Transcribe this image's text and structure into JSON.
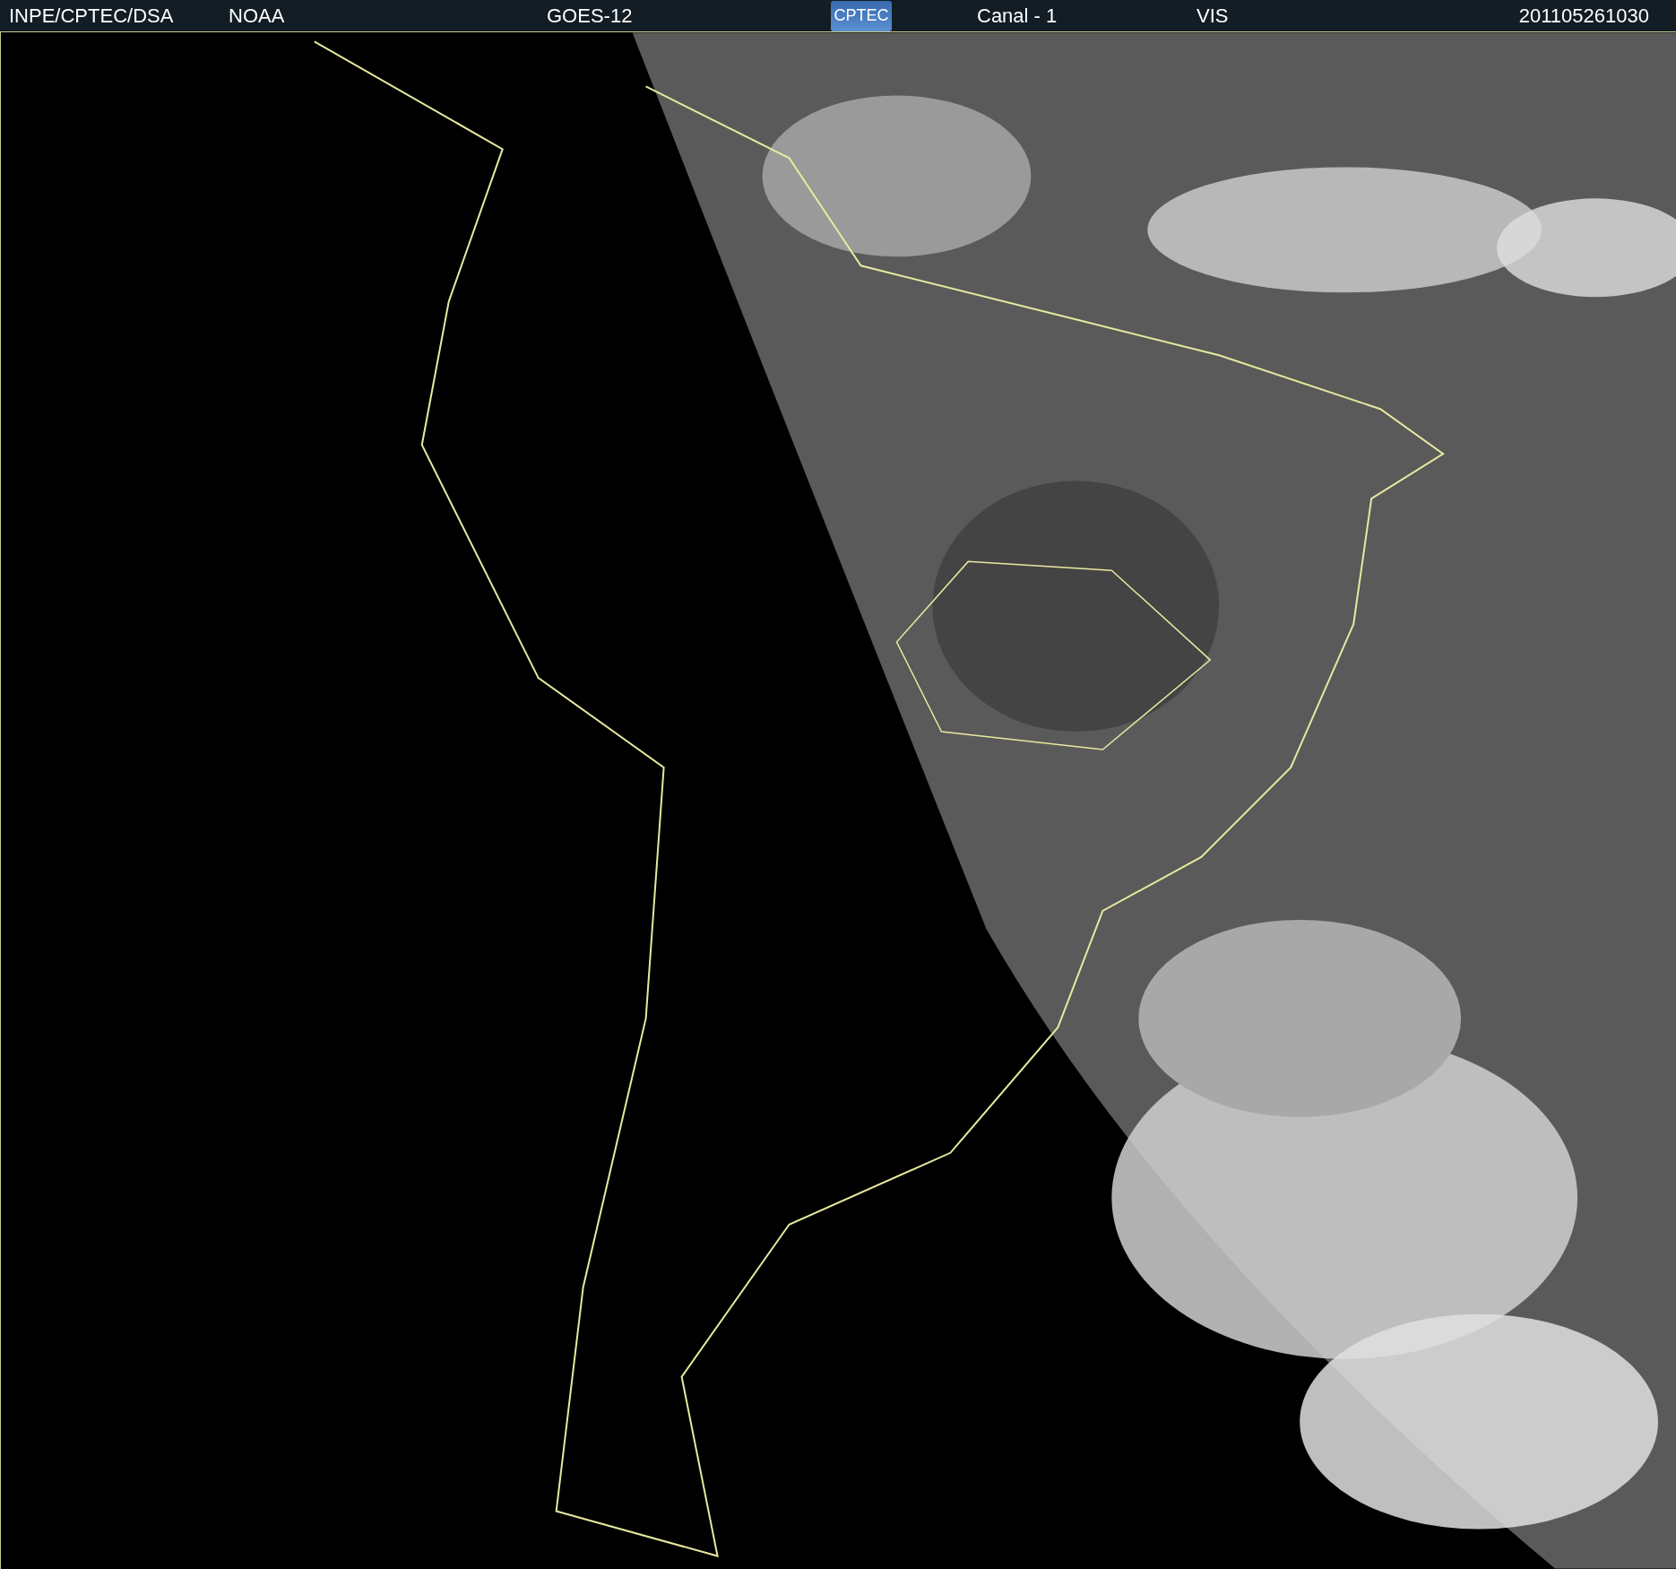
{
  "header": {
    "items": [
      {
        "kind": "text",
        "text": "INPE/CPTEC/DSA"
      },
      {
        "kind": "text",
        "text": "NOAA"
      },
      {
        "kind": "text",
        "text": "GOES-12"
      },
      {
        "kind": "logo",
        "text": "CPTEC"
      },
      {
        "kind": "text",
        "text": "Canal - 1"
      },
      {
        "kind": "text",
        "text": "VIS"
      },
      {
        "kind": "text",
        "text": "201105261030"
      }
    ]
  }
}
